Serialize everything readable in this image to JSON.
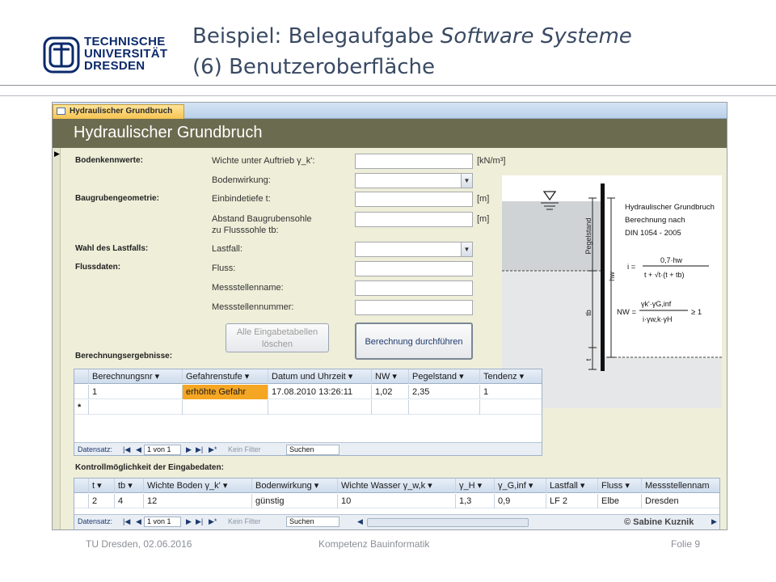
{
  "slide": {
    "logo_line1": "TECHNISCHE",
    "logo_line2": "UNIVERSITÄT",
    "logo_line3": "DRESDEN",
    "title_prefix": "Beispiel: Belegaufgabe ",
    "title_italic": "Software Systeme",
    "title_line2": "(6) Benutzeroberfläche"
  },
  "form": {
    "tab_label": "Hydraulischer Grundbruch",
    "title": "Hydraulischer Grundbruch",
    "sections": {
      "bodenkennwerte": "Bodenkennwerte:",
      "baugrubengeometrie": "Baugrubengeometrie:",
      "lastfall": "Wahl des Lastfalls:",
      "flussdaten": "Flussdaten:",
      "ergebnisse": "Berechnungsergebnisse:",
      "kontrolle": "Kontrollmöglichkeit der Eingabedaten:"
    },
    "fields": {
      "wichte_label": "Wichte unter Auftrieb γ_k':",
      "wichte_unit": "[kN/m³]",
      "bodenwirkung_label": "Bodenwirkung:",
      "einbindetiefe_label": "Einbindetiefe t:",
      "einbindetiefe_unit": "[m]",
      "abstand_label1": "Abstand Baugrubensohle",
      "abstand_label2": "zu Flusssohle tb:",
      "abstand_unit": "[m]",
      "lastfall_label": "Lastfall:",
      "fluss_label": "Fluss:",
      "messstellenname_label": "Messstellenname:",
      "messstellennummer_label": "Messstellennummer:"
    },
    "buttons": {
      "clear_line1": "Alle Eingabetabellen",
      "clear_line2": "löschen",
      "calculate": "Berechnung durchführen"
    }
  },
  "diagram": {
    "title1": "Hydraulischer Grundbruch",
    "title2": "Berechnung nach",
    "title3": "DIN 1054 - 2005",
    "label_pegelstand": "Pegelstand",
    "label_hw": "hw",
    "label_tb": "tb",
    "label_t": "t",
    "formula_i_lhs": "i =",
    "formula_i_num": "0,7·hw",
    "formula_i_den": "t + √t·(t + tb)",
    "formula_nw_lhs": "NW =",
    "formula_nw_num": "γk'·γG,inf",
    "formula_nw_den": "i·γw,k·γH",
    "formula_nw_rhs": "≥ 1"
  },
  "results_table": {
    "columns": [
      "Berechnungsnr",
      "Gefahrenstufe",
      "Datum und Uhrzeit",
      "NW",
      "Pegelstand",
      "Tendenz"
    ],
    "row": [
      "1",
      "erhöhte Gefahr",
      "17.08.2010 13:26:11",
      "1,02",
      "2,35",
      "1"
    ],
    "new_row_marker": "*",
    "highlight_color": "#f5a623"
  },
  "control_table": {
    "columns": [
      "t",
      "tb",
      "Wichte Boden γ_k'",
      "Bodenwirkung",
      "Wichte Wasser γ_w,k",
      "γ_H",
      "γ_G,inf",
      "Lastfall",
      "Fluss",
      "Messstellennam"
    ],
    "row": [
      "2",
      "4",
      "12",
      "günstig",
      "10",
      "1,3",
      "0,9",
      "LF 2",
      "Elbe",
      "Dresden"
    ]
  },
  "record_nav": {
    "label": "Datensatz:",
    "position": "1 von 1",
    "filter": "Kein Filter",
    "search": "Suchen"
  },
  "credit": "© Sabine Kuznik",
  "footer": {
    "left": "TU Dresden, 02.06.2016",
    "center": "Kompetenz Bauinformatik",
    "right": "Folie 9"
  }
}
